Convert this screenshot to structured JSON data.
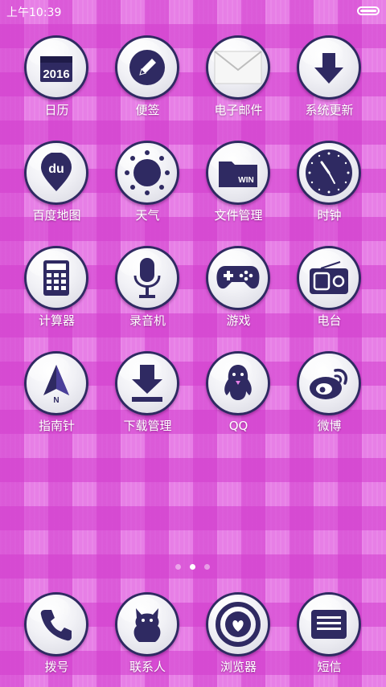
{
  "status_bar": {
    "time": "上午10:39"
  },
  "apps": [
    {
      "label": "日历",
      "icon": "calendar-icon",
      "text": "2016"
    },
    {
      "label": "便签",
      "icon": "pencil-icon"
    },
    {
      "label": "电子邮件",
      "icon": "envelope-icon"
    },
    {
      "label": "系统更新",
      "icon": "down-arrow-icon"
    },
    {
      "label": "百度地图",
      "icon": "map-pin-icon",
      "text": "du"
    },
    {
      "label": "天气",
      "icon": "sun-icon"
    },
    {
      "label": "文件管理",
      "icon": "folder-icon",
      "text": "WIN"
    },
    {
      "label": "时钟",
      "icon": "clock-icon"
    },
    {
      "label": "计算器",
      "icon": "calculator-icon"
    },
    {
      "label": "录音机",
      "icon": "microphone-icon"
    },
    {
      "label": "游戏",
      "icon": "gamepad-icon"
    },
    {
      "label": "电台",
      "icon": "radio-icon"
    },
    {
      "label": "指南针",
      "icon": "compass-icon",
      "text": "N"
    },
    {
      "label": "下载管理",
      "icon": "download-icon"
    },
    {
      "label": "QQ",
      "icon": "penguin-icon"
    },
    {
      "label": "微博",
      "icon": "weibo-icon"
    }
  ],
  "page_indicator": {
    "count": 3,
    "active": 2
  },
  "dock": [
    {
      "label": "拨号",
      "icon": "phone-icon"
    },
    {
      "label": "联系人",
      "icon": "contact-icon"
    },
    {
      "label": "浏览器",
      "icon": "browser-icon"
    },
    {
      "label": "短信",
      "icon": "message-icon"
    }
  ],
  "colors": {
    "icon_dark": "#2f2a62",
    "background": "#e77fe6"
  }
}
